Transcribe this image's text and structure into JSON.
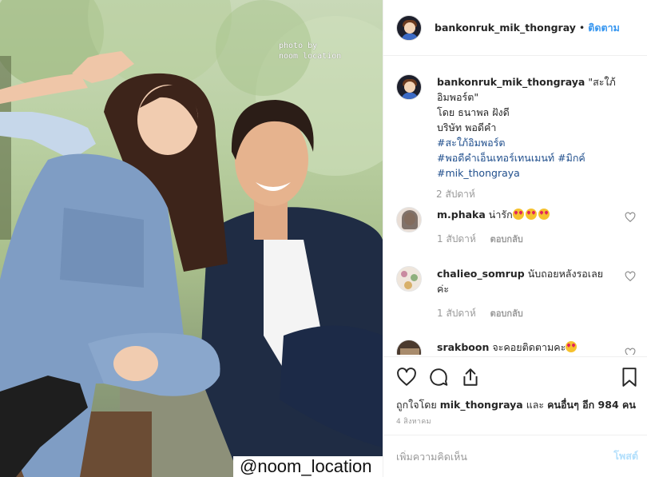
{
  "photo": {
    "watermark_top": [
      "photo by",
      "noom location"
    ],
    "watermark_bottom": "@noom_location"
  },
  "header": {
    "username": "bankonruk_mik_thongray",
    "separator": "•",
    "follow_label": "ติดตาม"
  },
  "caption": {
    "username": "bankonruk_mik_thongraya",
    "title_line1": "\"สะใภ้",
    "title_line2": "อิมพอร์ต\"",
    "line_by": "โดย ธนาพล ฝังดี",
    "line_company": "บริษัท พอดีคำ",
    "hashtags": [
      "#สะใภ้อิมพอร์ต",
      "#พอดีคำเอ็นเทอร์เทนเมนท์",
      "#มิกค์",
      "#mik_thongraya"
    ],
    "time": "2 สัปดาห์"
  },
  "comments": [
    {
      "username": "m.phaka",
      "text": "น่ารัก",
      "emoji_count": 3,
      "time": "1 สัปดาห์",
      "reply_label": "ตอบกลับ"
    },
    {
      "username": "chalieo_somrup",
      "text": "นับถอยหลังรอเลยค่ะ",
      "time": "1 สัปดาห์",
      "reply_label": "ตอบกลับ"
    },
    {
      "username": "srakboon",
      "text": "จะคอยติดตามคะ",
      "emoji_count": 1
    }
  ],
  "actions": {
    "icons": [
      "heart-icon",
      "comment-icon",
      "share-icon",
      "bookmark-icon"
    ],
    "likes_prefix": "ถูกใจโดย",
    "likes_user": "mik_thongraya",
    "likes_and": "และ",
    "likes_others": "คนอื่นๆ อีก 984 คน",
    "date": "4 สิงหาคม"
  },
  "comment_box": {
    "placeholder": "เพิ่มความคิดเห็น",
    "post_label": "โพสต์"
  },
  "colors": {
    "link": "#3897f0",
    "hashtag": "#1f4e8c",
    "muted": "#999999"
  }
}
